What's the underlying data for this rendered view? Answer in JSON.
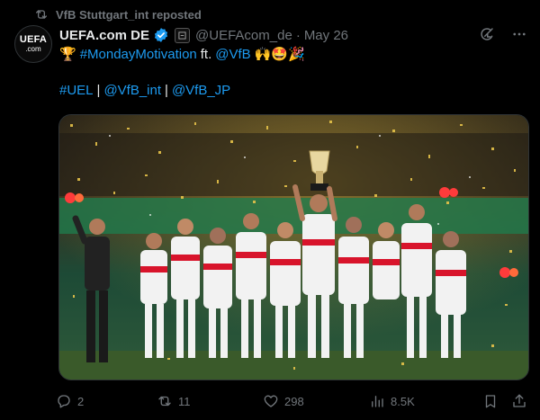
{
  "repost": {
    "text": "VfB Stuttgart_int reposted"
  },
  "author": {
    "avatar_line1": "UEFA",
    "avatar_line2": ".com",
    "name": "UEFA.com DE",
    "handle": "@UEFAcom_de",
    "separator": "·",
    "date": "May 26"
  },
  "tweet": {
    "line1": {
      "emoji_trophy": "🏆",
      "hashtag": "#MondayMotivation",
      "ft": "ft.",
      "mention": "@VfB",
      "emojis": "🙌🤩🎉"
    },
    "line2": {
      "tag1": "#UEL",
      "sep1": "|",
      "tag2": "@VfB_int",
      "sep2": "|",
      "tag3": "@VfB_JP"
    }
  },
  "photo": {
    "scene": "trophy-celebration"
  },
  "metrics": {
    "replies": "2",
    "reposts": "11",
    "likes": "298",
    "views": "8.5K"
  },
  "colors": {
    "background": "#000000",
    "text": "#e7e9ea",
    "muted": "#71767b",
    "link": "#1d9bf0"
  }
}
